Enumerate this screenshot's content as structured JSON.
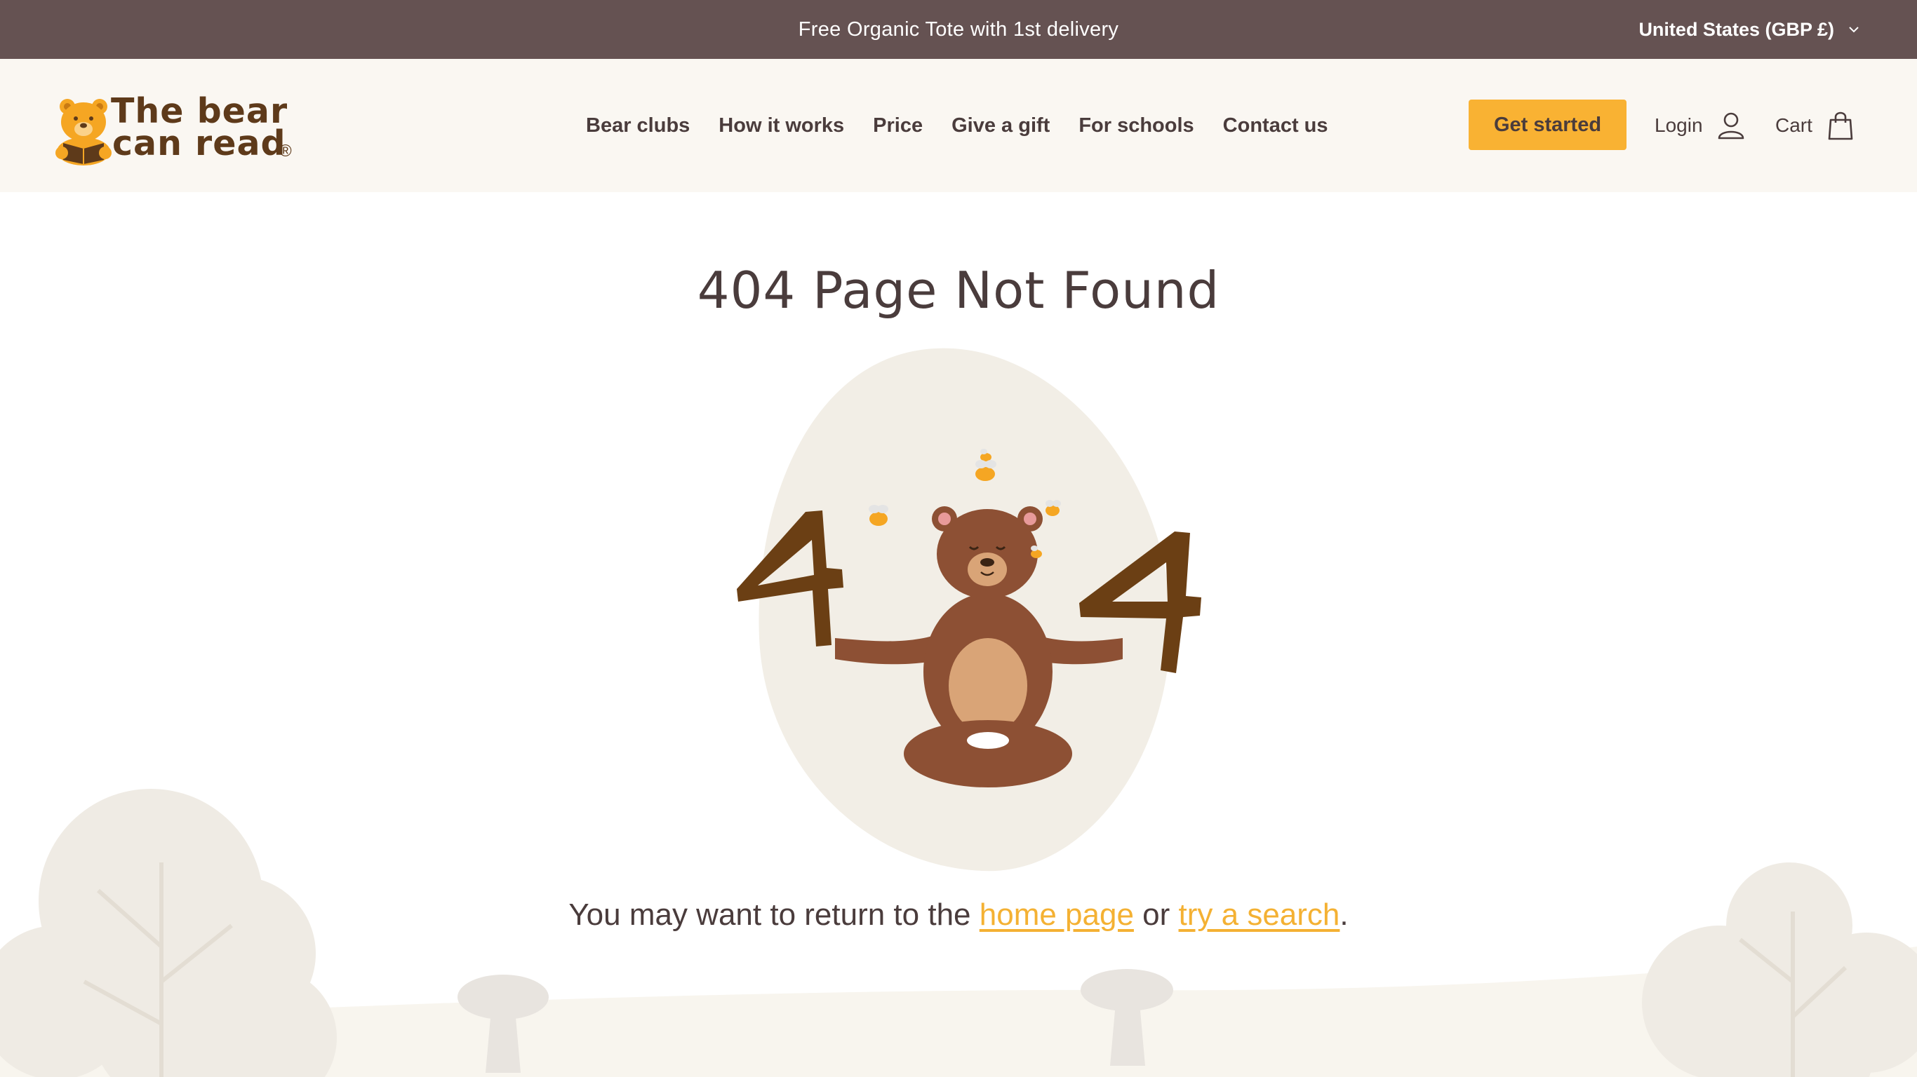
{
  "announcement": {
    "text": "Free Organic Tote with 1st delivery"
  },
  "country_selector": {
    "label": "United States (GBP £)"
  },
  "logo": {
    "line1": "The bear",
    "line2": "can read",
    "registered": "®"
  },
  "nav": {
    "items": [
      {
        "label": "Bear clubs"
      },
      {
        "label": "How it works"
      },
      {
        "label": "Price"
      },
      {
        "label": "Give a gift"
      },
      {
        "label": "For schools"
      },
      {
        "label": "Contact us"
      }
    ]
  },
  "header_actions": {
    "cta_label": "Get started",
    "login_label": "Login",
    "cart_label": "Cart"
  },
  "main": {
    "title": "404 Page Not Found",
    "message_prefix": "You may want to return to the",
    "home_link": "home page",
    "message_middle": "or",
    "search_link": "try a search",
    "message_suffix": "."
  },
  "colors": {
    "announcement_bg": "#655252",
    "header_bg": "#faf7f2",
    "accent": "#f9b233",
    "link": "#f4b133",
    "text": "#4a3c3c",
    "digit_brown": "#6b3f14",
    "bear_brown": "#8d5034"
  }
}
